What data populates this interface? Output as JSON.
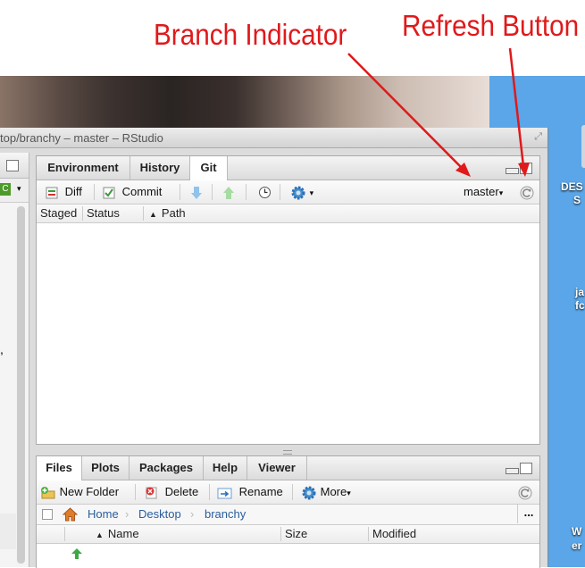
{
  "annotations": {
    "branch": "Branch Indicator",
    "refresh": "Refresh Button"
  },
  "window": {
    "title": "top/branchy – master – RStudio"
  },
  "desktop": {
    "labels": [
      "DES",
      "S",
      "ja",
      "fc",
      "W",
      "er"
    ]
  },
  "git_pane": {
    "tabs": [
      "Environment",
      "History",
      "Git"
    ],
    "active_tab": "Git",
    "toolbar": {
      "diff": "Diff",
      "commit": "Commit",
      "branch": "master"
    },
    "columns": [
      "Staged",
      "Status",
      "Path"
    ],
    "rows": []
  },
  "files_pane": {
    "tabs": [
      "Files",
      "Plots",
      "Packages",
      "Help",
      "Viewer"
    ],
    "active_tab": "Files",
    "toolbar": {
      "new_folder": "New Folder",
      "delete": "Delete",
      "rename": "Rename",
      "more": "More"
    },
    "breadcrumb": [
      "Home",
      "Desktop",
      "branchy"
    ],
    "columns": [
      "Name",
      "Size",
      "Modified"
    ],
    "more_label": "..."
  },
  "colors": {
    "annotation": "#e0191b",
    "accent": "#2a6fb8"
  }
}
